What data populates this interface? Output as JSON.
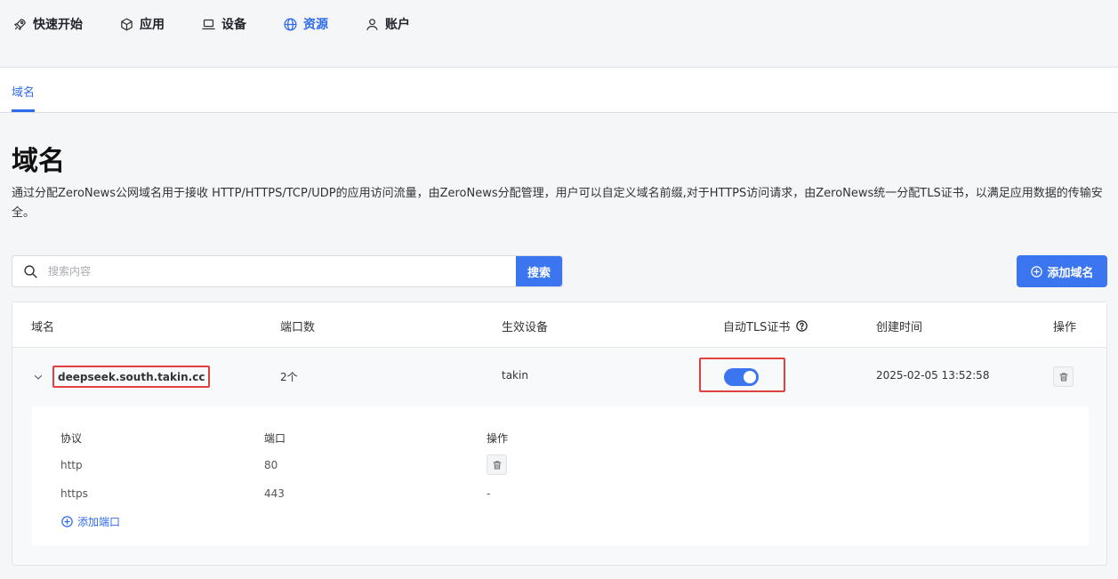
{
  "nav": {
    "items": [
      {
        "label": "快速开始",
        "icon": "rocket-icon"
      },
      {
        "label": "应用",
        "icon": "cube-icon"
      },
      {
        "label": "设备",
        "icon": "laptop-icon"
      },
      {
        "label": "资源",
        "icon": "globe-icon",
        "active": true
      },
      {
        "label": "账户",
        "icon": "user-icon"
      }
    ]
  },
  "subnav": {
    "tab": "域名"
  },
  "page": {
    "title": "域名",
    "description": "通过分配ZeroNews公网域名用于接收 HTTP/HTTPS/TCP/UDP的应用访问流量，由ZeroNews分配管理，用户可以自定义域名前缀,对于HTTPS访问请求，由ZeroNews统一分配TLS证书，以满足应用数据的传输安全。"
  },
  "search": {
    "placeholder": "搜索内容",
    "value": "",
    "button": "搜索"
  },
  "add_button": "添加域名",
  "table": {
    "headers": [
      "域名",
      "端口数",
      "生效设备",
      "自动TLS证书",
      "创建时间",
      "操作"
    ],
    "rows": [
      {
        "domain": "deepseek.south.takin.cc",
        "ports": "2个",
        "device": "takin",
        "auto_tls": true,
        "created": "2025-02-05 13:52:58",
        "expanded": true,
        "sub": {
          "headers": [
            "协议",
            "端口",
            "操作"
          ],
          "rows": [
            {
              "protocol": "http",
              "port": "80",
              "action": "trash-icon"
            },
            {
              "protocol": "https",
              "port": "443",
              "action": "-"
            }
          ],
          "add_label": "添加端口"
        }
      }
    ]
  },
  "colors": {
    "accent": "#3b76f0",
    "highlight": "#e24040"
  }
}
